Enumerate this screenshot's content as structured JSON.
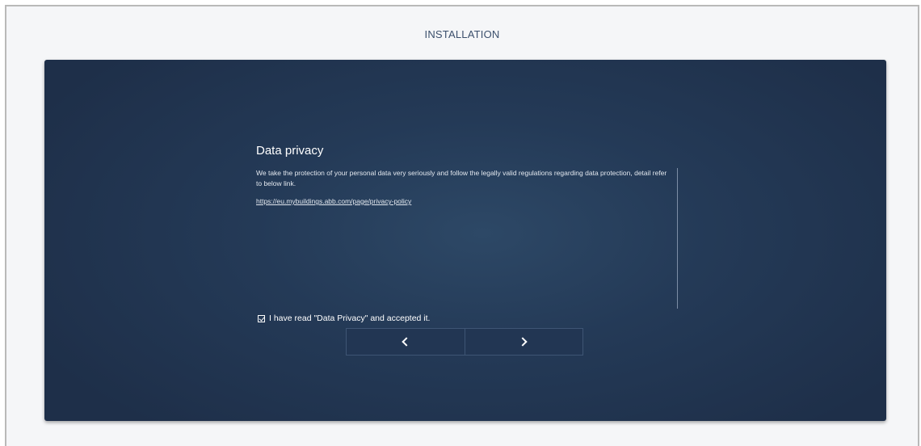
{
  "header": {
    "title": "INSTALLATION"
  },
  "privacy": {
    "title": "Data privacy",
    "body": "We take the protection of your personal data very seriously and follow the legally valid regulations regarding data protection, detail refer to below link.",
    "link_text": "https://eu.mybuildings.abb.com/page/privacy-policy"
  },
  "consent": {
    "label": "I have read \"Data Privacy\" and accepted it.",
    "checked": true
  },
  "navigation": {
    "back_icon": "chevron-left-icon",
    "next_icon": "chevron-right-icon"
  }
}
